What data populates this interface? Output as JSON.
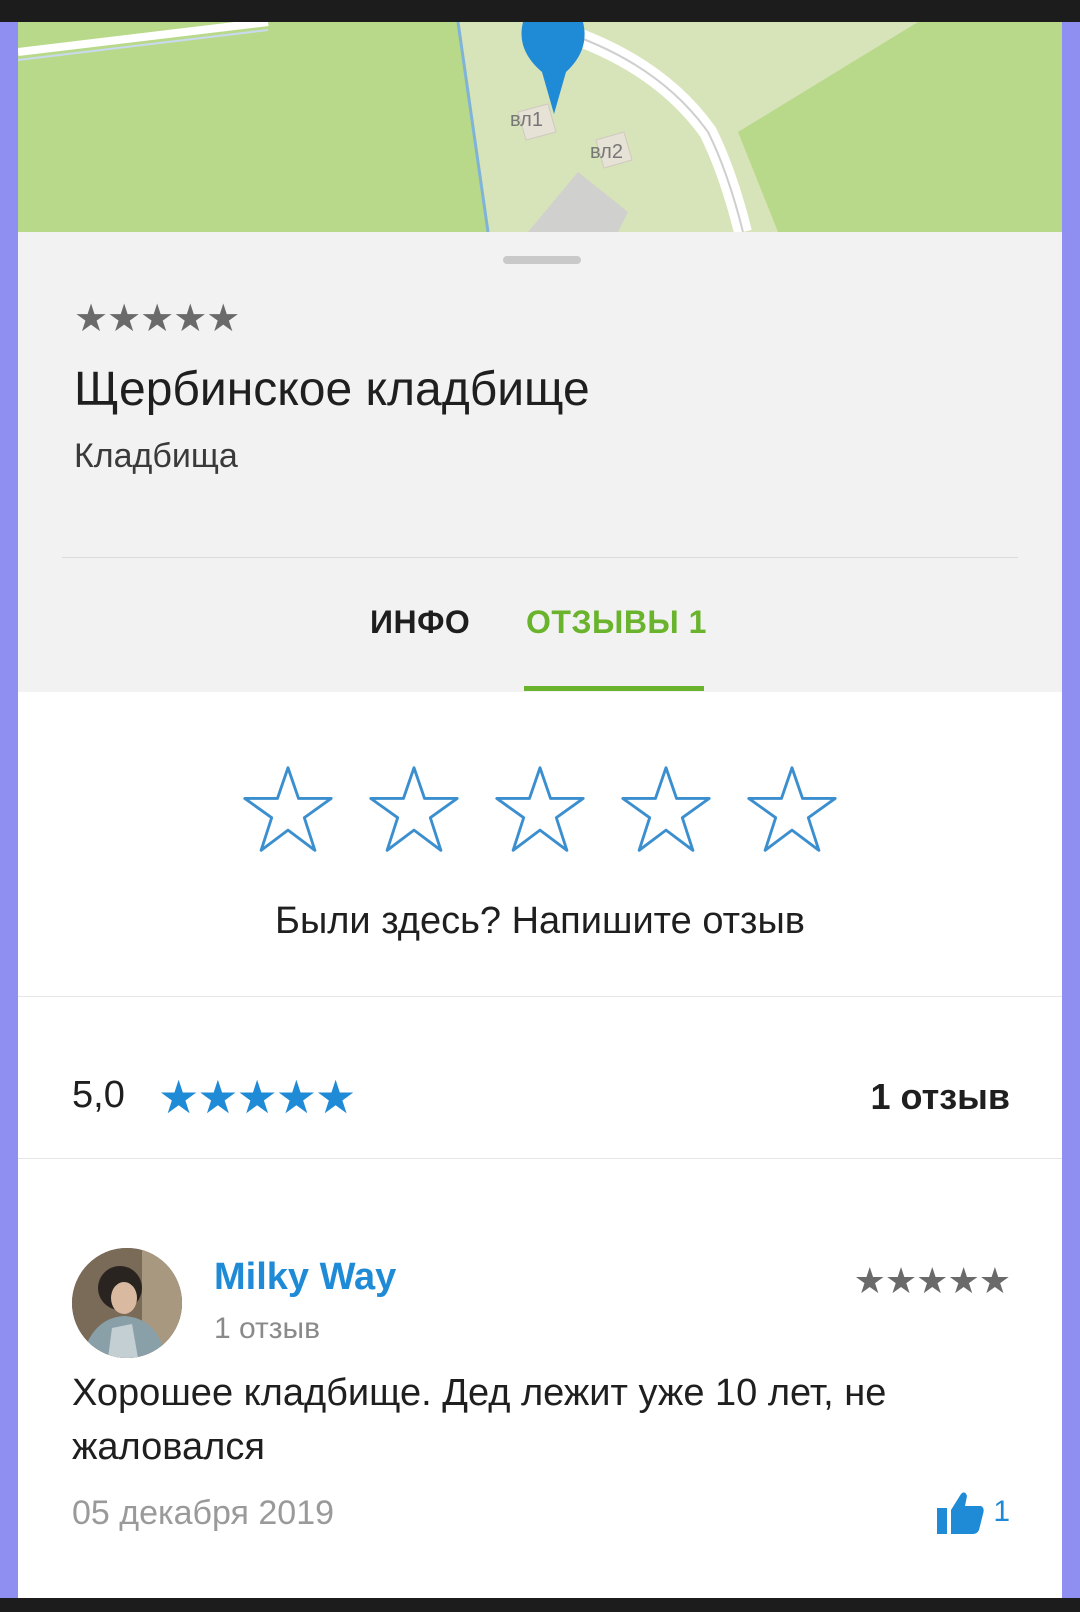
{
  "map": {
    "labels": [
      "вл1",
      "вл2"
    ],
    "pin_icon": "location-pin-icon"
  },
  "place": {
    "rating_stars": "★★★★★",
    "name": "Щербинское кладбище",
    "category": "Кладбища"
  },
  "tabs": [
    {
      "label": "ИНФО",
      "active": false
    },
    {
      "label": "ОТЗЫВЫ 1",
      "active": true
    }
  ],
  "rate": {
    "star_icon": "star-outline-icon",
    "stars_count": 5,
    "prompt": "Были здесь? Напишите отзыв"
  },
  "summary": {
    "score": "5,0",
    "stars": "★★★★★",
    "review_count": "1 отзыв"
  },
  "review": {
    "author": "Milky Way",
    "author_reviews": "1 отзыв",
    "stars": "★★★★★",
    "text": "Хорошее кладбище. Дед лежит уже 10 лет, не жаловался",
    "date": "05 декабря 2019",
    "likes": "1",
    "like_icon": "thumbs-up-icon"
  },
  "colors": {
    "accent_green": "#6ab42d",
    "link_blue": "#1f8ad6",
    "map_green": "#b9d98a"
  }
}
